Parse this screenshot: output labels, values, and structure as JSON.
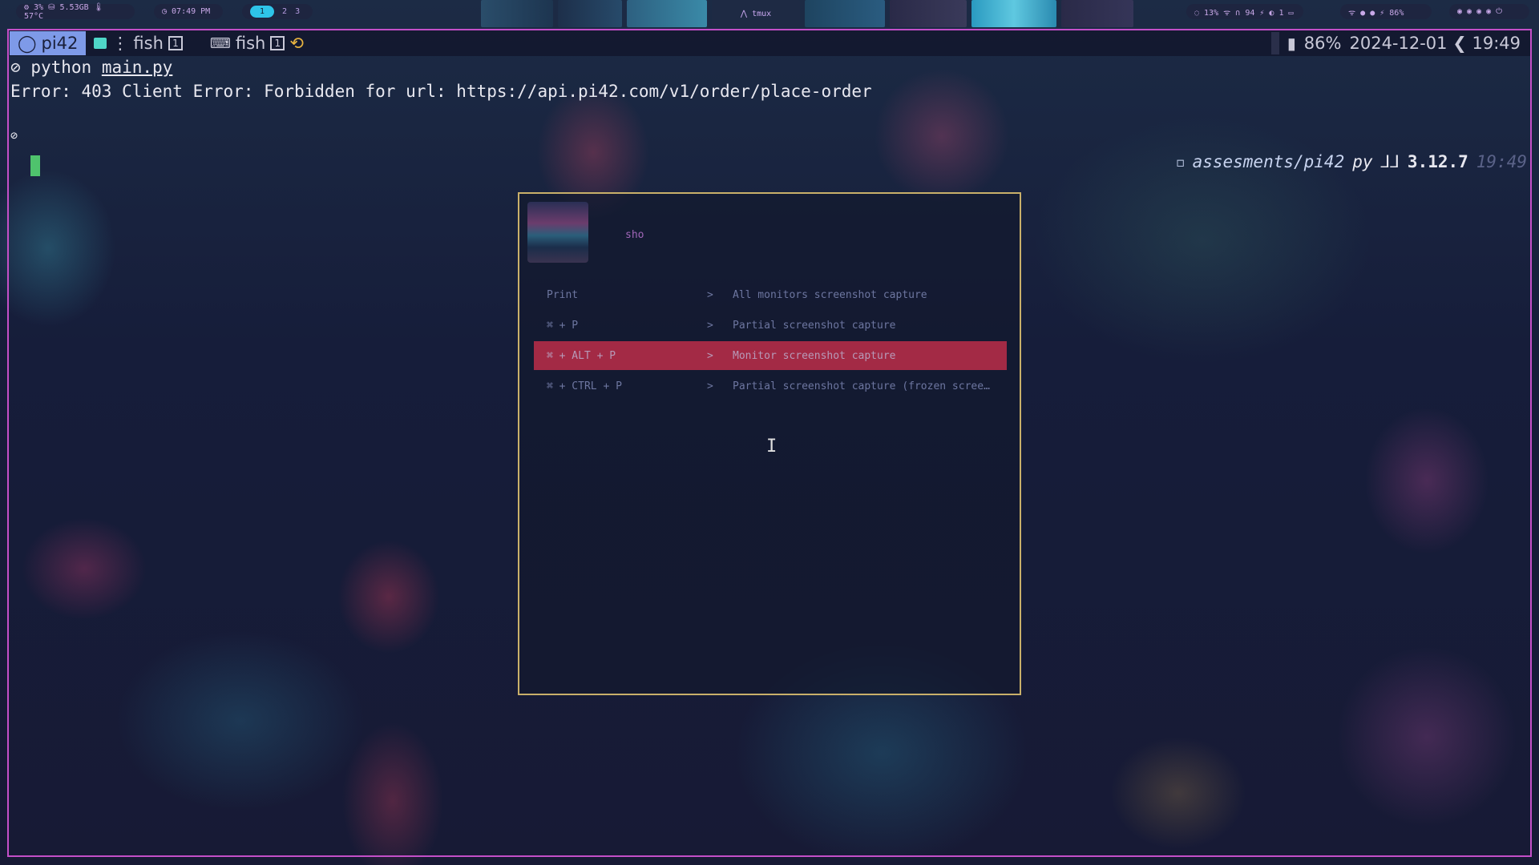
{
  "topbar": {
    "sysinfo": "⚙ 3%  ⛁ 5.53GB  🌡 57°C",
    "clock": "◷ 07:49 PM",
    "workspaces": [
      "1",
      "2",
      "3"
    ],
    "active_workspace": "1",
    "tmux_label": "⋀ tmux",
    "right_info": "◌ 13%  ᯤ  ∩ 94  ⚡  ◐ 1  ▭",
    "right_icons": "ᯤ  ●  ●  ⚡ 86%",
    "power_icons": "◉ ◉ ◉ ◉ ⏻"
  },
  "tmux": {
    "session_icon": "◯",
    "session_name": "pi42",
    "window1_label": "fish",
    "window1_index": "1",
    "window2_label": "fish",
    "window2_index": "1",
    "battery": "86%",
    "datetime": "2024-12-01 ❮ 19:49"
  },
  "terminal": {
    "prompt_symbol": "⊘",
    "command_prefix": "python ",
    "command_arg": "main.py",
    "error_line": "Error: 403 Client Error: Forbidden for url: https://api.pi42.com/v1/order/place-order",
    "right_prompt": {
      "folder_icon": "◻",
      "path": "assesments/pi42",
      "lang": "py",
      "version": "3.12.7",
      "time": "19:49"
    }
  },
  "launcher": {
    "query": "sho",
    "entries": [
      {
        "key": "Print",
        "arrow": ">",
        "desc": "All monitors screenshot capture",
        "selected": false
      },
      {
        "key": "⌘ + P",
        "arrow": ">",
        "desc": "Partial screenshot capture",
        "selected": false
      },
      {
        "key": "⌘ + ALT + P",
        "arrow": ">",
        "desc": "Monitor screenshot capture",
        "selected": true
      },
      {
        "key": "⌘ + CTRL + P",
        "arrow": ">",
        "desc": "Partial screenshot capture (frozen scree…",
        "selected": false
      }
    ]
  },
  "colors": {
    "accent_border": "#c44fc8",
    "launcher_border": "#c9b06a",
    "selection": "#a32a45",
    "session_bg": "#7e9ae8",
    "cursor": "#4fc36d"
  }
}
